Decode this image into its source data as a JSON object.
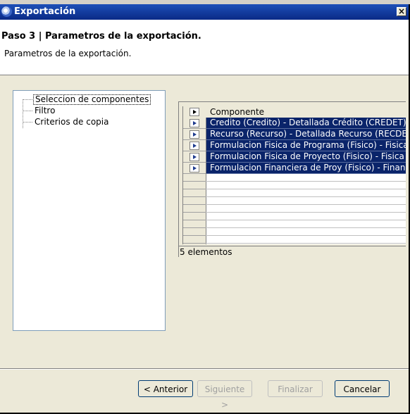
{
  "window": {
    "title": "Exportación",
    "close_label": "×"
  },
  "header": {
    "title": "Paso 3 | Parametros de la exportación.",
    "description": "Parametros de la exportación."
  },
  "tree": {
    "items": [
      {
        "label": "Seleccion de componentes",
        "selected": true
      },
      {
        "label": "Filtro",
        "selected": false
      },
      {
        "label": "Criterios de copia",
        "selected": false
      }
    ]
  },
  "grid": {
    "column_header": "Componente",
    "rows": [
      "Credito (Credito) - Detallada Crédito (CREDET)",
      "Recurso (Recurso) - Detallada Recurso (RECDE",
      "Formulacion Fisica de Programa (Fisico) - Fisica",
      "Formulacion Fisica de Proyecto (Fisico) - Fisica",
      "Formulacion Financiera de Proy (Fisico) - Finan."
    ],
    "selection_color": "#0a246a",
    "status": "5 elementos"
  },
  "buttons": {
    "back": "< Anterior",
    "next": "Siguiente >",
    "finish": "Finalizar",
    "cancel": "Cancelar"
  }
}
